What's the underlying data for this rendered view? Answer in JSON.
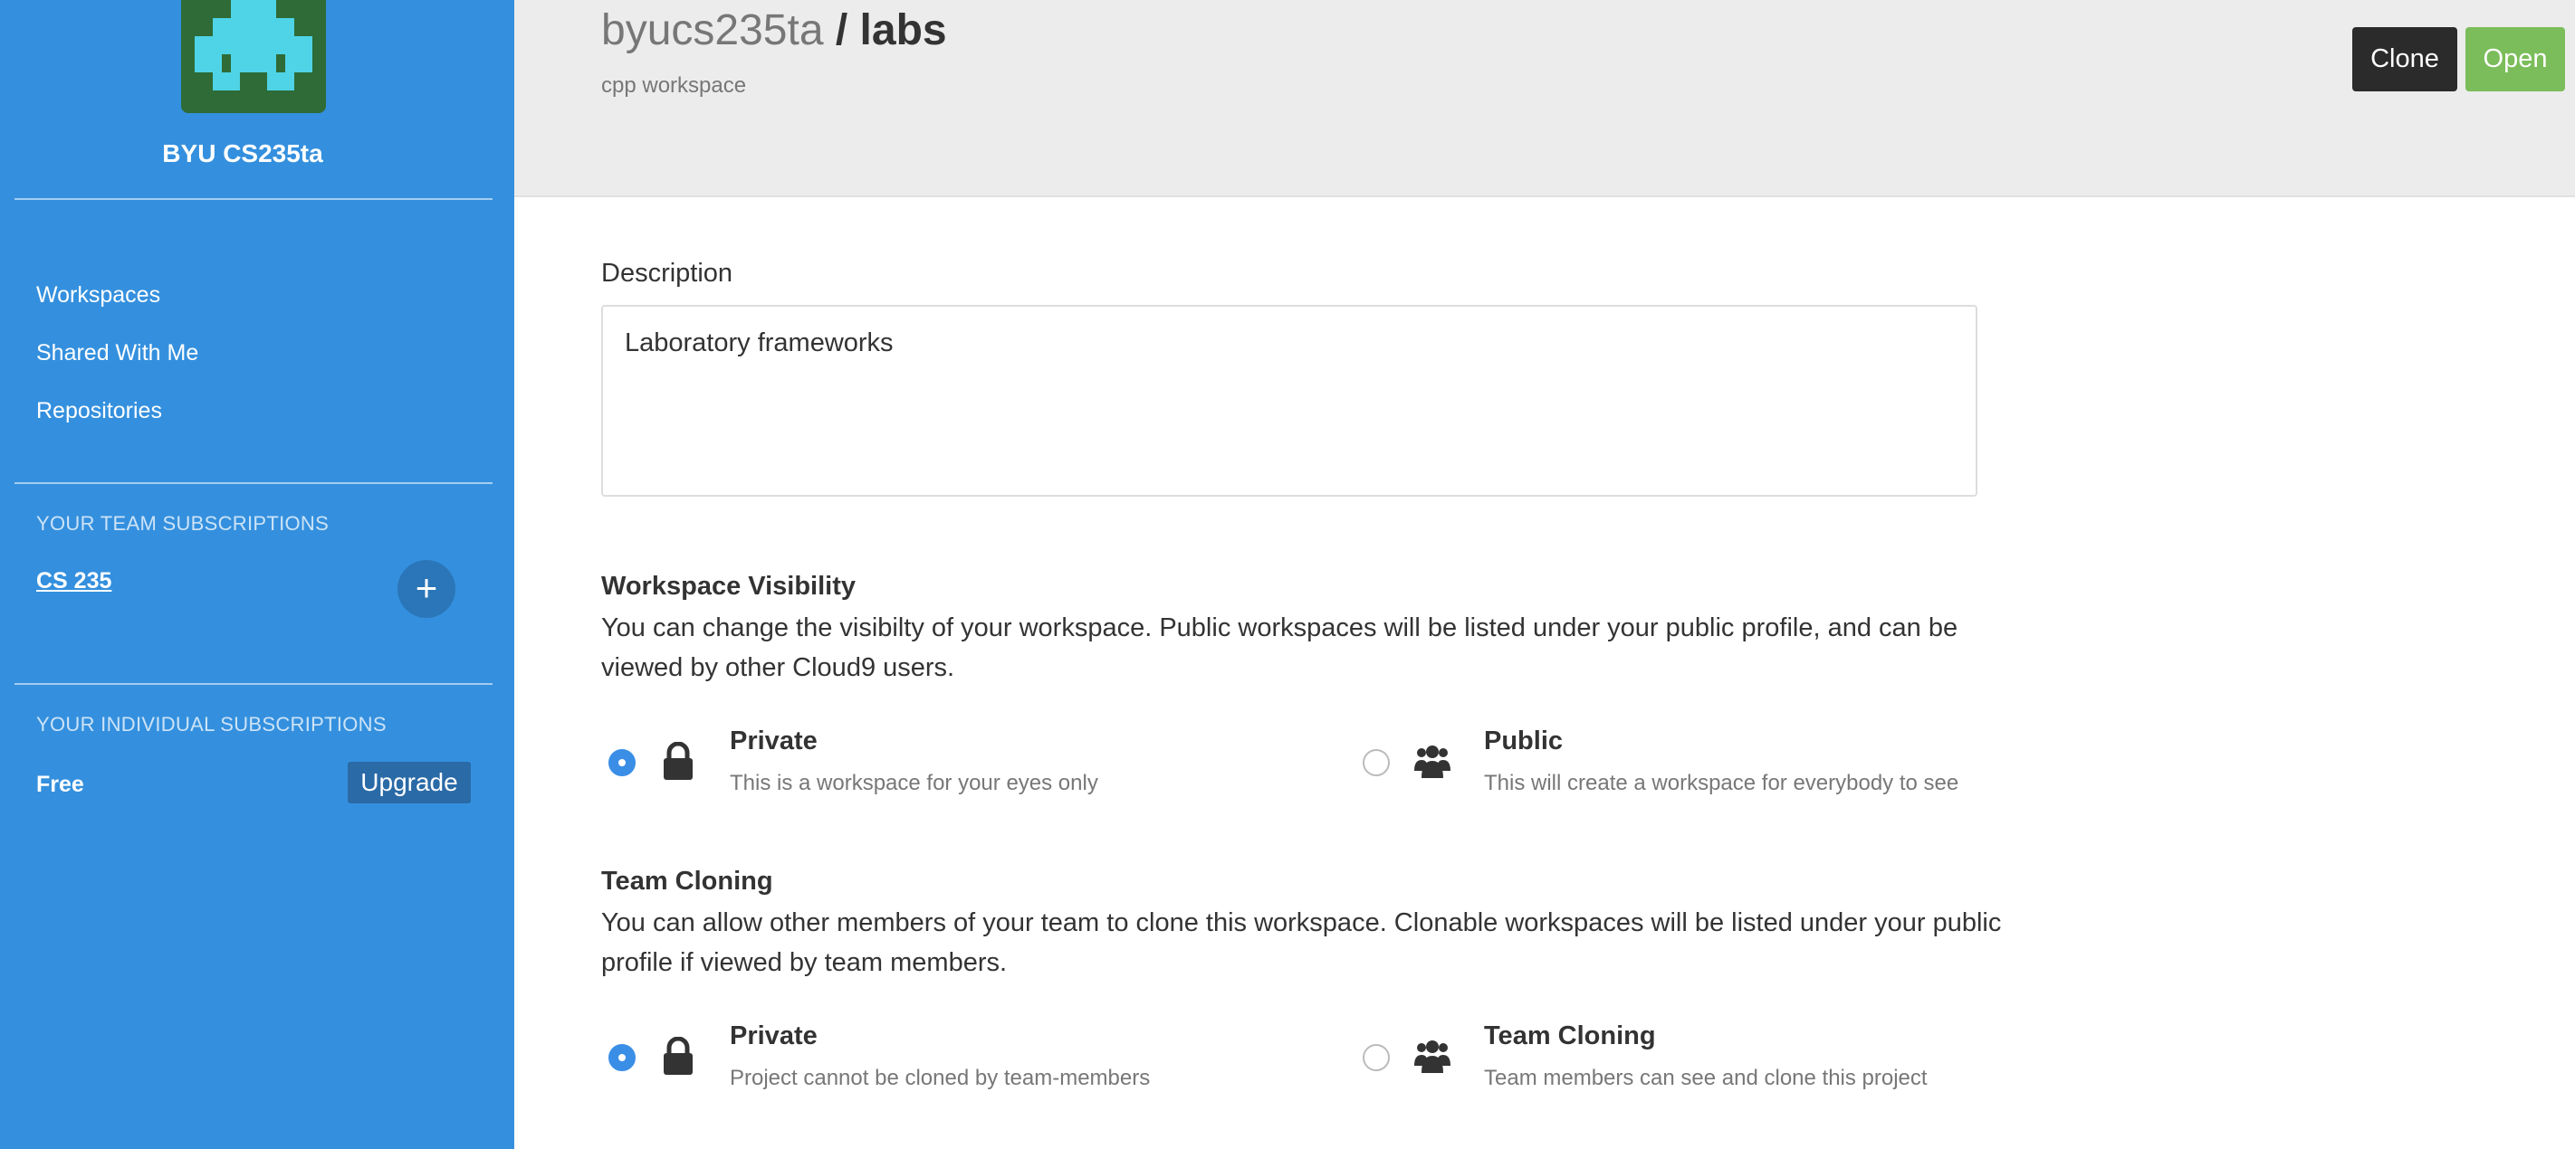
{
  "sidebar": {
    "team_name": "BYU CS235ta",
    "nav": [
      "Workspaces",
      "Shared With Me",
      "Repositories"
    ],
    "team_subscriptions_label": "YOUR TEAM SUBSCRIPTIONS",
    "team_link": "CS 235",
    "add_symbol": "+",
    "individual_subscriptions_label": "YOUR INDIVIDUAL SUBSCRIPTIONS",
    "plan": "Free",
    "upgrade_label": "Upgrade"
  },
  "header": {
    "owner": "byucs235ta",
    "slash": " / ",
    "name": "labs",
    "subtitle": "cpp workspace",
    "clone_label": "Clone",
    "open_label": "Open"
  },
  "description": {
    "label": "Description",
    "value": "Laboratory frameworks"
  },
  "visibility": {
    "title": "Workspace Visibility",
    "text": "You can change the visibilty of your workspace. Public workspaces will be listed under your public profile, and can be viewed by other Cloud9 users.",
    "options": [
      {
        "title": "Private",
        "desc": "This is a workspace for your eyes only",
        "selected": true,
        "icon": "lock-icon"
      },
      {
        "title": "Public",
        "desc": "This will create a workspace for everybody to see",
        "selected": false,
        "icon": "group-icon"
      }
    ]
  },
  "cloning": {
    "title": "Team Cloning",
    "text": "You can allow other members of your team to clone this workspace. Clonable workspaces will be listed under your public profile if viewed by team members.",
    "options": [
      {
        "title": "Private",
        "desc": "Project cannot be cloned by team-members",
        "selected": true,
        "icon": "lock-icon"
      },
      {
        "title": "Team Cloning",
        "desc": "Team members can see and clone this project",
        "selected": false,
        "icon": "group-icon"
      }
    ]
  },
  "colors": {
    "sidebar": "#3490de",
    "accent": "#3a8ee6",
    "open_button": "#7bbd5a",
    "clone_button": "#2b2b2b"
  }
}
